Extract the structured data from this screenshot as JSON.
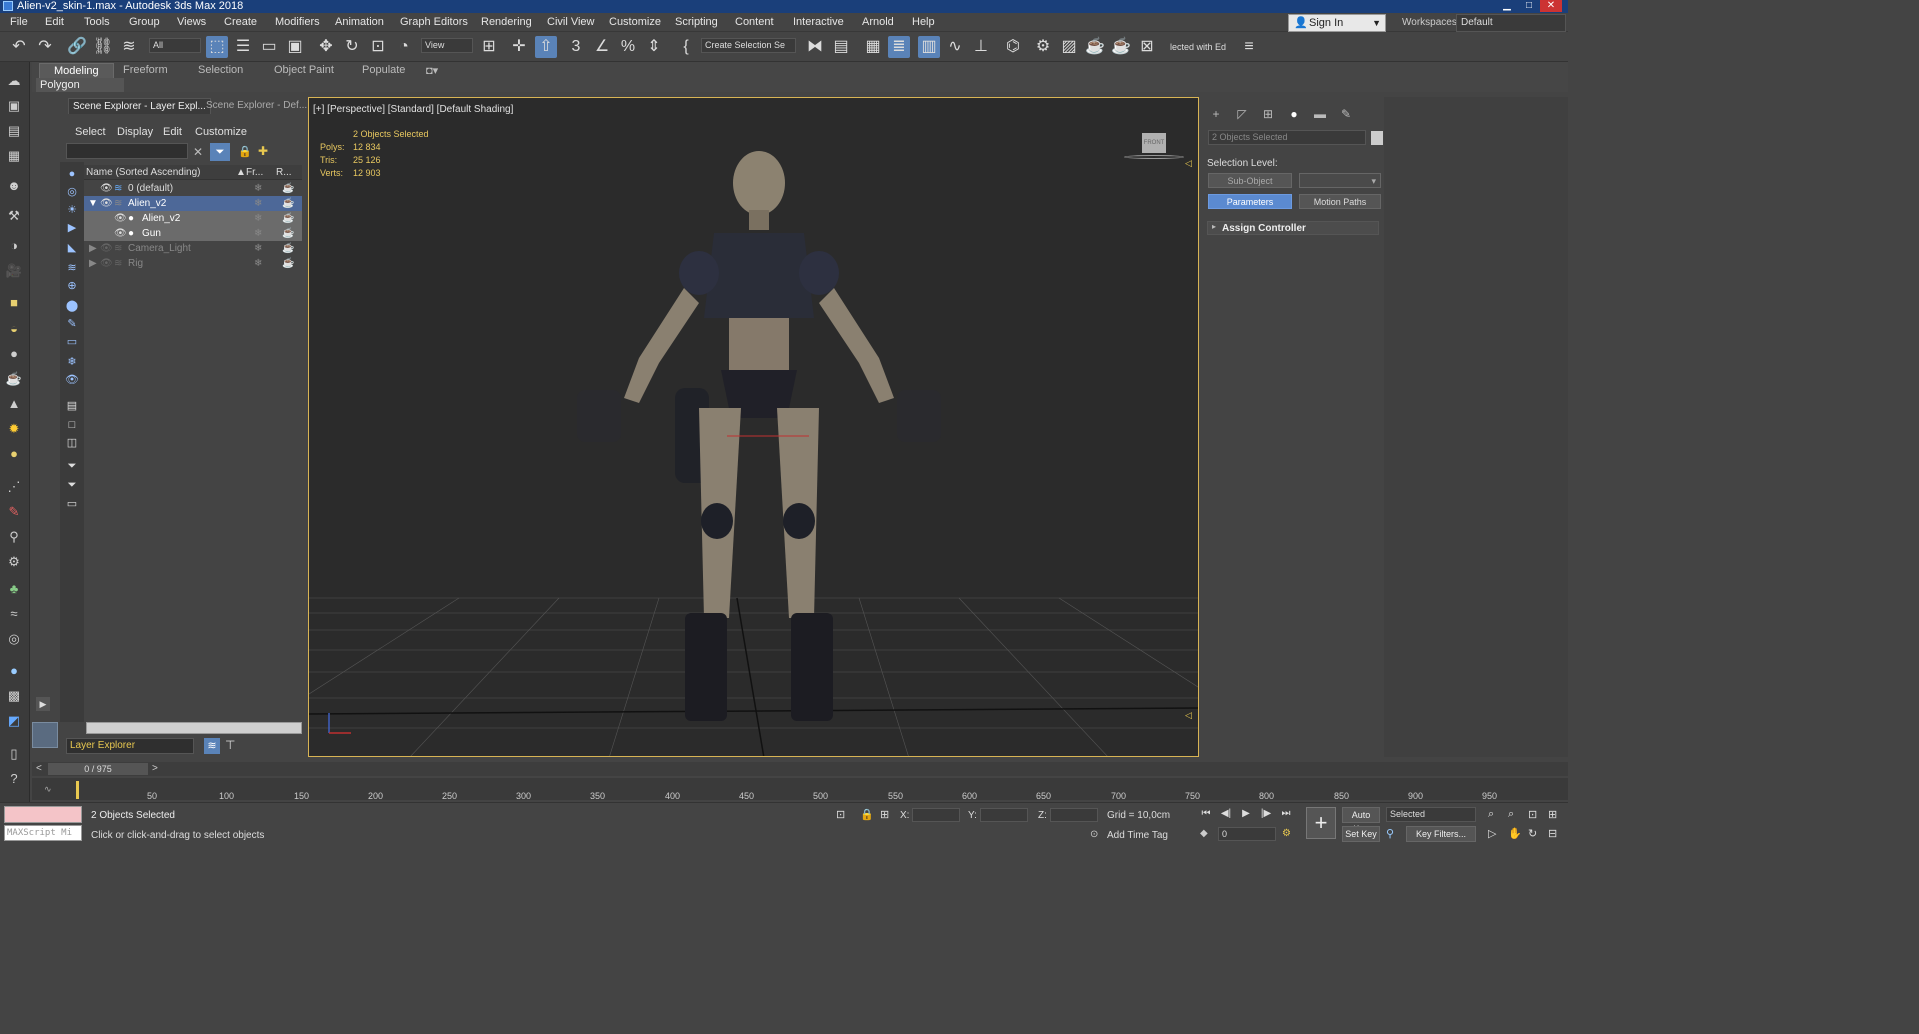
{
  "window": {
    "title": "Alien-v2_skin-1.max - Autodesk 3ds Max 2018"
  },
  "menu": [
    "File",
    "Edit",
    "Tools",
    "Group",
    "Views",
    "Create",
    "Modifiers",
    "Animation",
    "Graph Editors",
    "Rendering",
    "Civil View",
    "Customize",
    "Scripting",
    "Content",
    "Interactive",
    "Arnold",
    "Help"
  ],
  "account": {
    "sign_in": "Sign In",
    "workspaces_label": "Workspaces:",
    "workspace": "Default"
  },
  "toolbar": {
    "filter": "All",
    "ref_coord": "View",
    "selection_set": "Create Selection Se",
    "cropped_label": "lected with Ed"
  },
  "ribbon": {
    "tabs": [
      "Modeling",
      "Freeform",
      "Selection",
      "Object Paint",
      "Populate"
    ],
    "active": "Modeling",
    "subpanel": "Polygon Modeling"
  },
  "scene_explorer": {
    "tabs": [
      "Scene Explorer - Layer Expl...",
      "Scene Explorer - Def..."
    ],
    "menu": [
      "Select",
      "Display",
      "Edit",
      "Customize"
    ],
    "columns": [
      "Name (Sorted Ascending)",
      "Fr...",
      "R..."
    ],
    "rows": [
      {
        "label": "0 (default)"
      },
      {
        "label": "Alien_v2"
      },
      {
        "label": "Alien_v2"
      },
      {
        "label": "Gun"
      },
      {
        "label": "Camera_Light"
      },
      {
        "label": "Rig"
      }
    ],
    "mode": "Layer Explorer"
  },
  "viewport": {
    "label": "[+] [Perspective] [Standard] [Default Shading]",
    "stats_header": "2 Objects Selected",
    "stats": [
      {
        "name": "Polys:",
        "value": "12 834"
      },
      {
        "name": "Tris:",
        "value": "25 126"
      },
      {
        "name": "Verts:",
        "value": "12 903"
      }
    ],
    "viewcube": "FRONT"
  },
  "command_panel": {
    "selection_name": "2 Objects Selected",
    "selection_level": "Selection Level:",
    "sub_object": "Sub-Object",
    "parameters": "Parameters",
    "motion_paths": "Motion Paths",
    "assign_controller": "Assign Controller"
  },
  "timeline": {
    "frame": "0 / 975",
    "ticks": [
      "50",
      "100",
      "150",
      "200",
      "250",
      "300",
      "350",
      "400",
      "450",
      "500",
      "550",
      "600",
      "650",
      "700",
      "750",
      "800",
      "850",
      "900",
      "950"
    ]
  },
  "status": {
    "maxscript": "MAXScript Mi",
    "selected": "2 Objects Selected",
    "hint": "Click or click-and-drag to select objects",
    "x": "X:",
    "y": "Y:",
    "z": "Z:",
    "grid": "Grid = 10,0cm",
    "add_time_tag": "Add Time Tag",
    "auto_key": "Auto Key",
    "set_key": "Set Key",
    "selected_dropdown": "Selected",
    "key_filters": "Key Filters...",
    "frame_field": "0"
  }
}
